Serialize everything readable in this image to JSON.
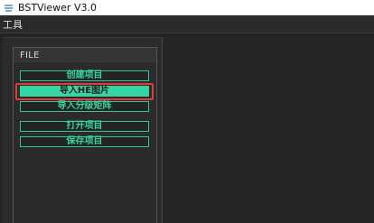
{
  "window": {
    "title": "BSTViewer V3.0",
    "icon": "app-logo-icon"
  },
  "menubar": {
    "items": [
      {
        "label": "工具"
      }
    ]
  },
  "panel": {
    "group_title": "FILE",
    "buttons": [
      {
        "label": "创建项目",
        "state": "normal"
      },
      {
        "label": "导入HE图片",
        "state": "selected"
      },
      {
        "label": "导入分级矩阵",
        "state": "normal"
      },
      {
        "label": "打开项目",
        "state": "normal"
      },
      {
        "label": "保存项目",
        "state": "normal"
      }
    ]
  },
  "colors": {
    "accent": "#35d6a3",
    "highlight": "#e23b3b",
    "background": "#242424"
  }
}
